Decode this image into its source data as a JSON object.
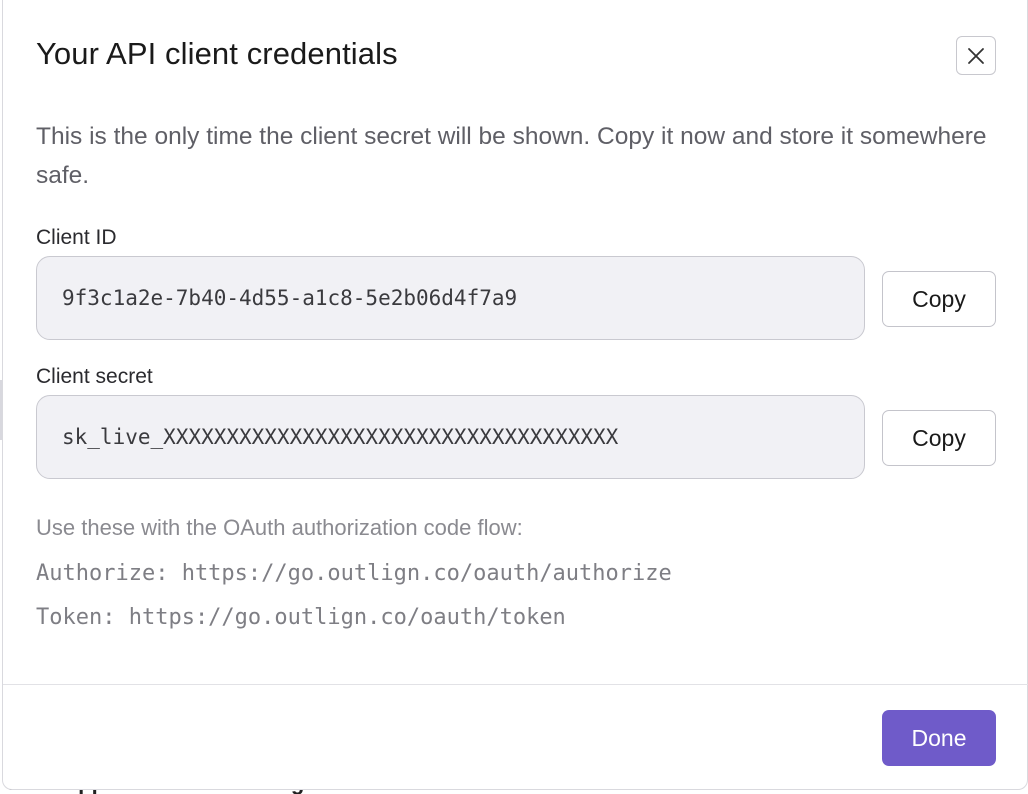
{
  "background": {
    "text": "ds or apps. Start automating and save time."
  },
  "modal": {
    "title": "Your API client credentials",
    "intro": "This is the only time the client secret will be shown. Copy it now and store it somewhere safe.",
    "client_id": {
      "label": "Client ID",
      "value": "9f3c1a2e-7b40-4d55-a1c8-5e2b06d4f7a9",
      "copy_label": "Copy"
    },
    "client_secret": {
      "label": "Client secret",
      "value": "sk_live_XXXXXXXXXXXXXXXXXXXXXXXXXXXXXXXXXXXX",
      "copy_label": "Copy"
    },
    "hint": "Use these with the OAuth authorization code flow:",
    "authorize_line": "Authorize: https://go.outlign.co/oauth/authorize",
    "token_line": "Token: https://go.outlign.co/oauth/token",
    "done_label": "Done"
  },
  "colors": {
    "primary": "#6f5bc9",
    "field_bg": "#f1f1f5",
    "muted_text": "#8a8a90"
  },
  "icons": {
    "close": "close-icon"
  }
}
